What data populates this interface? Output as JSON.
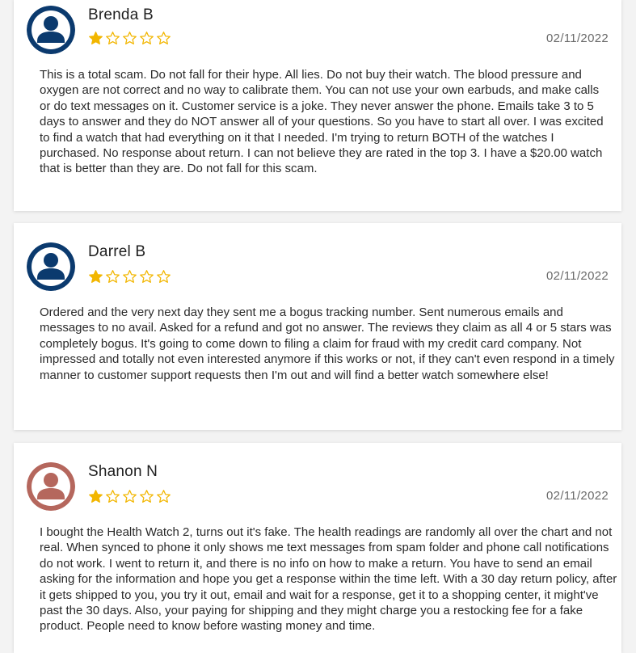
{
  "reviews": [
    {
      "name": "Brenda B",
      "rating": 1,
      "max_rating": 5,
      "date": "02/11/2022",
      "avatar_color": "#0b3a6e",
      "text": "This is a total scam. Do not fall for their hype. All lies. Do not buy their watch. The blood pressure and oxygen are not correct and no way to calibrate them. You can not use your own earbuds, and make calls or do text messages on it. Customer service is a joke. They never answer the phone. Emails take 3 to 5 days to answer and they do NOT answer all of your questions. So you have to start all over. I was excited to find a watch that had everything on it that I needed. I'm trying to return BOTH of the watches I purchased. No response about return. I can not believe they are rated in the top 3. I have a $20.00 watch that is better than they are. Do not fall for this scam."
    },
    {
      "name": "Darrel B",
      "rating": 1,
      "max_rating": 5,
      "date": "02/11/2022",
      "avatar_color": "#0b3a6e",
      "text": "Ordered and the very next day they sent me a bogus tracking number. Sent numerous emails and messages to no avail. Asked for a refund and got no answer. The reviews they claim as all 4 or 5 stars was completely bogus. It's going to come down to filing a claim for fraud with my credit card company. Not impressed and totally not even interested anymore if this works or not, if they can't even respond in a timely manner to customer support requests then I'm out and will find a better watch somewhere else!"
    },
    {
      "name": "Shanon N",
      "rating": 1,
      "max_rating": 5,
      "date": "02/11/2022",
      "avatar_color": "#b5675d",
      "text": "I bought the Health Watch 2, turns out it's fake. The health readings are randomly all over the chart and not real. When synced to phone it only shows me text messages from spam folder and phone call notifications do not work. I went to return it, and there is no info on how to make a return. You have to send an email asking for the information and hope you get a response within the time left. With a 30 day return policy, after it gets shipped to you, you try it out, email and wait for a response, get it to a shopping center, it might've past the 30 days. Also, your paying for shipping and they might charge you a restocking fee for a fake product. People need to know before wasting money and time."
    }
  ],
  "colors": {
    "star_fill": "#f2b600",
    "star_outline": "#f2b600"
  }
}
